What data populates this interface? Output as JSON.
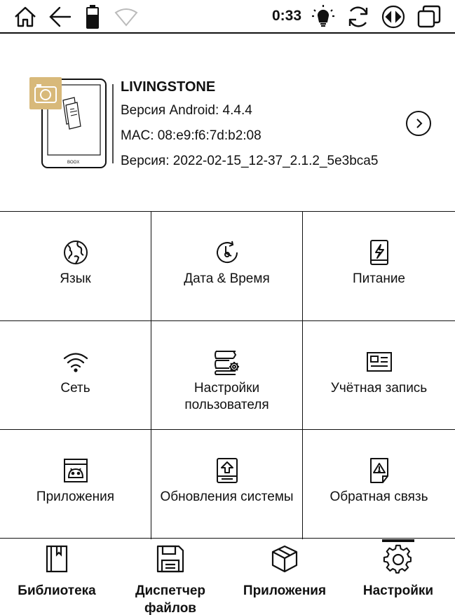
{
  "status_bar": {
    "time": "0:33",
    "icons": [
      "home-icon",
      "back-arrow-icon",
      "battery-icon",
      "wifi-icon",
      "frontlight-icon",
      "refresh-icon",
      "contrast-mode-icon",
      "recent-apps-icon"
    ]
  },
  "device": {
    "name": "LIVINGSTONE",
    "android_version": "Версия Android: 4.4.4",
    "mac": "MAC: 08:e9:f6:7d:b2:08",
    "firmware": "Версия: 2022-02-15_12-37_2.1.2_5e3bca5",
    "logo_text": "BOOX"
  },
  "settings_grid": [
    {
      "label": "Язык",
      "icon": "globe-icon"
    },
    {
      "label": "Дата & Время",
      "icon": "clock-icon"
    },
    {
      "label": "Питание",
      "icon": "power-icon"
    },
    {
      "label": "Сеть",
      "icon": "wifi-icon"
    },
    {
      "label": "Настройки пользователя",
      "icon": "user-settings-icon"
    },
    {
      "label": "Учётная запись",
      "icon": "account-card-icon"
    },
    {
      "label": "Приложения",
      "icon": "android-icon"
    },
    {
      "label": "Обновления системы",
      "icon": "system-update-icon"
    },
    {
      "label": "Обратная связь",
      "icon": "feedback-icon"
    }
  ],
  "bottom_nav": [
    {
      "label": "Библиотека",
      "icon": "library-icon"
    },
    {
      "label": "Диспетчер файлов",
      "icon": "floppy-disk-icon"
    },
    {
      "label": "Приложения",
      "icon": "apps-box-icon"
    },
    {
      "label": "Настройки",
      "icon": "gear-icon",
      "active": true
    }
  ],
  "colors": {
    "ink": "#111111",
    "camera_badge": "#d8b97a"
  }
}
